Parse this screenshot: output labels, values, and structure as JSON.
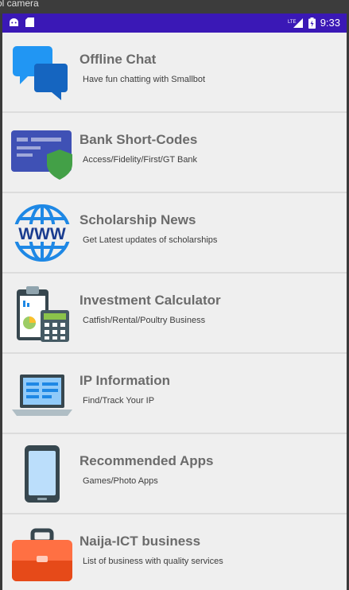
{
  "window": {
    "title": "rol camera"
  },
  "statusbar": {
    "time": "9:33",
    "network": "LTE"
  },
  "items": [
    {
      "title": "Offline Chat",
      "subtitle": "Have fun chatting with Smallbot",
      "icon": "chat-bubbles-icon"
    },
    {
      "title": "Bank Short-Codes",
      "subtitle": "Access/Fidelity/First/GT Bank",
      "icon": "bank-card-shield-icon"
    },
    {
      "title": "Scholarship News",
      "subtitle": "Get Latest updates of scholarships",
      "icon": "www-globe-icon"
    },
    {
      "title": "Investment Calculator",
      "subtitle": "Catfish/Rental/Poultry Business",
      "icon": "clipboard-calculator-icon"
    },
    {
      "title": "IP Information",
      "subtitle": "Find/Track Your IP",
      "icon": "laptop-icon"
    },
    {
      "title": "Recommended Apps",
      "subtitle": "Games/Photo Apps",
      "icon": "smartphone-icon"
    },
    {
      "title": "Naija-ICT business",
      "subtitle": "List of business with quality services",
      "icon": "briefcase-icon"
    }
  ],
  "colors": {
    "statusbar": "#3a18b6",
    "background": "#efefef",
    "title": "#6b6b6b"
  }
}
